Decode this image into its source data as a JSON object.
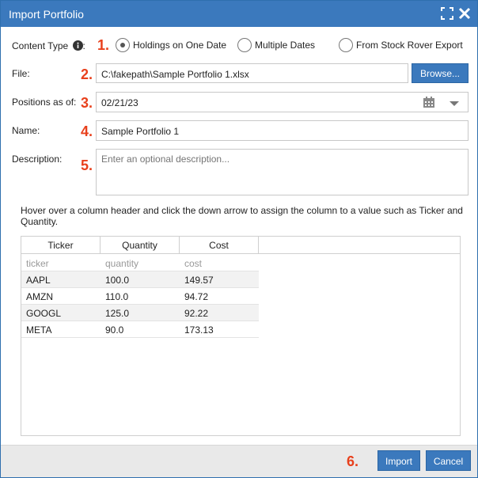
{
  "dialog": {
    "title": "Import Portfolio",
    "icons": {
      "maximize": "maximize-icon",
      "close": "close-icon"
    }
  },
  "content_type": {
    "label": "Content Type",
    "info_icon": "info-icon",
    "step": "1.",
    "options": [
      {
        "label": "Holdings on One Date",
        "selected": true
      },
      {
        "label": "Multiple Dates",
        "selected": false
      },
      {
        "label": "From Stock Rover Export",
        "selected": false
      }
    ]
  },
  "file": {
    "label": "File:",
    "step": "2.",
    "value": "C:\\fakepath\\Sample Portfolio 1.xlsx",
    "browse_label": "Browse..."
  },
  "positions_as_of": {
    "label": "Positions as of:",
    "step": "3.",
    "value": "02/21/23",
    "icons": {
      "calendar": "calendar-icon",
      "dropdown": "chevron-down-icon"
    }
  },
  "name": {
    "label": "Name:",
    "step": "4.",
    "value": "Sample Portfolio 1"
  },
  "description": {
    "label": "Description:",
    "step": "5.",
    "value": "",
    "placeholder": "Enter an optional description..."
  },
  "hint_text": "Hover over a column header and click the down arrow to assign the column to a value such as Ticker and Quantity.",
  "grid": {
    "columns": [
      "Ticker",
      "Quantity",
      "Cost"
    ],
    "source_headers": [
      "ticker",
      "quantity",
      "cost"
    ],
    "rows": [
      [
        "AAPL",
        "100.0",
        "149.57"
      ],
      [
        "AMZN",
        "110.0",
        "94.72"
      ],
      [
        "GOOGL",
        "125.0",
        "92.22"
      ],
      [
        "META",
        "90.0",
        "173.13"
      ]
    ]
  },
  "footer": {
    "step": "6.",
    "import_label": "Import",
    "cancel_label": "Cancel"
  },
  "colors": {
    "accent": "#3b79bd",
    "step_numbers": "#e8401c",
    "footer_bg": "#e9e9e9"
  }
}
